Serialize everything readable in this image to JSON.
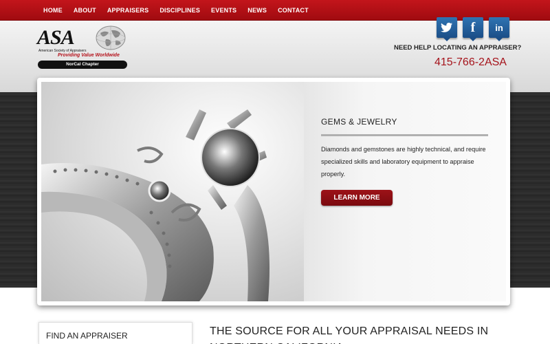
{
  "nav": {
    "items": [
      {
        "label": "HOME"
      },
      {
        "label": "ABOUT"
      },
      {
        "label": "APPRAISERS"
      },
      {
        "label": "DISCIPLINES"
      },
      {
        "label": "EVENTS"
      },
      {
        "label": "NEWS"
      },
      {
        "label": "CONTACT"
      }
    ]
  },
  "logo": {
    "wordmark": "ASA",
    "society": "American Society of Appraisers",
    "tagline": "Providing Value Worldwide",
    "chapter": "NorCal Chapter"
  },
  "social": {
    "twitter_icon": "twitter-icon",
    "facebook_icon": "facebook-icon",
    "linkedin_icon": "linkedin-icon",
    "facebook_glyph": "f",
    "linkedin_glyph": "in"
  },
  "contact": {
    "prompt": "NEED HELP LOCATING AN APPRAISER?",
    "phone": "415-766-2ASA"
  },
  "slide": {
    "title": "GEMS & JEWELRY",
    "text": "Diamonds and gemstones are highly technical, and require specialized skills and laboratory equipment to appraise properly.",
    "button": "LEARN MORE",
    "image": "diamond-ring-image"
  },
  "sidebar": {
    "find_title": "FIND AN APPRAISER"
  },
  "main": {
    "headline": "THE SOURCE FOR ALL YOUR APPRAISAL NEEDS IN NORTHERN CALIFORNIA"
  },
  "colors": {
    "brand_red": "#b5121b",
    "nav_red": "#c3151b",
    "social_blue": "#2f74b3"
  }
}
